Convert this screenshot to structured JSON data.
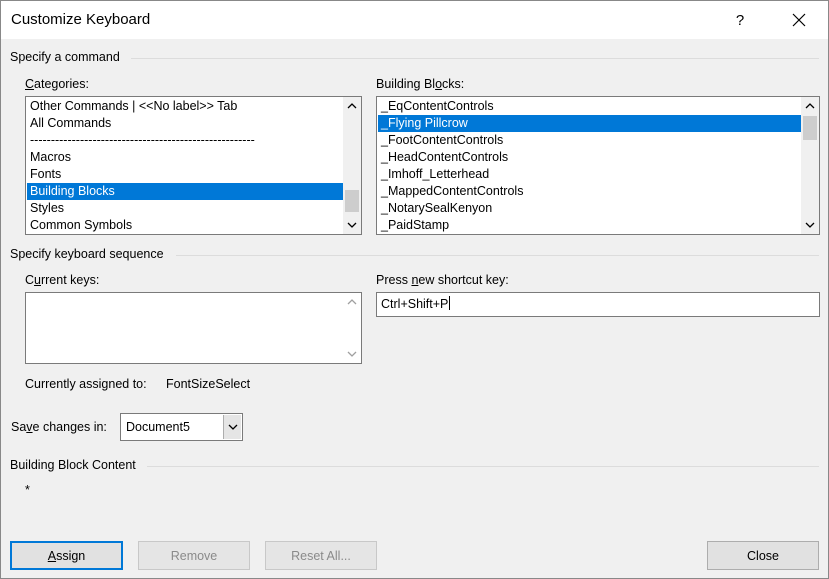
{
  "window": {
    "title": "Customize Keyboard",
    "help_label": "?"
  },
  "specify_command": {
    "group_label": "Specify a command",
    "categories": {
      "label_accel": "C",
      "label_rest": "ategories:",
      "items": [
        "Other Commands | <<No label>> Tab",
        "All Commands",
        "------------------------------------------------------",
        "Macros",
        "Fonts",
        "Building Blocks",
        "Styles",
        "Common Symbols"
      ],
      "selected_index": 5
    },
    "building_blocks": {
      "label_pre": "Building Bl",
      "label_accel": "o",
      "label_post": "cks:",
      "items": [
        "_EqContentControls",
        "_Flying Pillcrow",
        "_FootContentControls",
        "_HeadContentControls",
        "_Imhoff_Letterhead",
        "_MappedContentControls",
        "_NotarySealKenyon",
        "_PaidStamp"
      ],
      "selected_index": 1
    }
  },
  "keyboard_sequence": {
    "group_label": "Specify keyboard sequence",
    "current_keys": {
      "label_accel": "u",
      "label_pre": "C",
      "label_post": "rrent keys:",
      "items": []
    },
    "new_shortcut": {
      "label_pre": "Press ",
      "label_accel": "n",
      "label_post": "ew shortcut key:",
      "value": "Ctrl+Shift+P"
    },
    "currently_assigned_label": "Currently assigned to:",
    "currently_assigned_value": "FontSizeSelect"
  },
  "save_changes": {
    "label_pre": "Sa",
    "label_accel": "v",
    "label_post": "e changes in:",
    "value": "Document5"
  },
  "block_content": {
    "group_label": "Building Block Content",
    "value": "*"
  },
  "buttons": {
    "assign_accel": "A",
    "assign_rest": "ssign",
    "remove": "Remove",
    "reset_all": "Reset All...",
    "close": "Close"
  }
}
